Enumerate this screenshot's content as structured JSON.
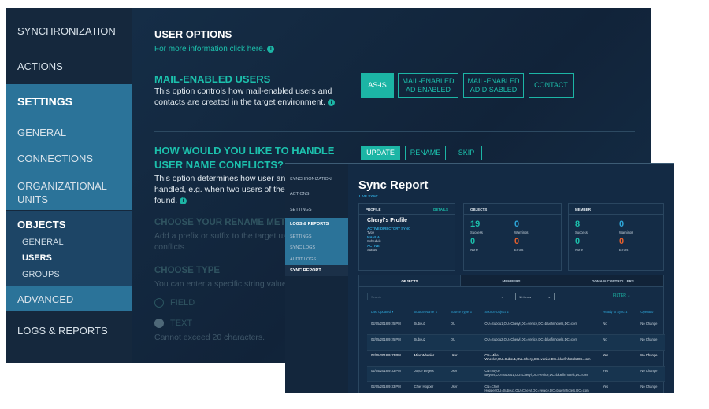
{
  "back": {
    "sidebar": {
      "synchronization": "SYNCHRONIZATION",
      "actions": "ACTIONS",
      "settings": "SETTINGS",
      "general": "GENERAL",
      "connections": "CONNECTIONS",
      "org_units": "ORGANIZATIONAL UNITS",
      "objects": "OBJECTS",
      "obj_general": "GENERAL",
      "users": "USERS",
      "groups": "GROUPS",
      "advanced": "ADVANCED",
      "logs": "LOGS & REPORTS"
    },
    "title": "USER OPTIONS",
    "more_info": "For more information click here.",
    "mail": {
      "heading": "MAIL-ENABLED USERS",
      "desc": "This option controls how mail-enabled users and contacts are created in the target environment.",
      "buttons": [
        "AS-IS",
        "MAIL-ENABLED AD ENABLED",
        "MAIL-ENABLED AD DISABLED",
        "CONTACT"
      ]
    },
    "conflict": {
      "heading1": "HOW WOULD YOU LIKE TO HANDLE",
      "heading2": "USER NAME CONFLICTS?",
      "desc1": "This option determines how user and co",
      "desc2": "handled, e.g. when two users of the sam",
      "desc3": "found.",
      "buttons": [
        "UPDATE",
        "RENAME",
        "SKIP"
      ]
    },
    "rename": {
      "heading": "CHOOSE YOUR RENAME METHOD",
      "desc1": "Add a prefix or suffix to the target user to",
      "desc2": "conflicts."
    },
    "type": {
      "heading": "CHOOSE TYPE",
      "desc": "You can enter a specific string value or s",
      "field": "FIELD",
      "text": "TEXT",
      "note": "Cannot exceed 20 characters."
    }
  },
  "front": {
    "sidebar": [
      "SYNCHRONIZATION",
      "ACTIONS",
      "SETTINGS",
      "LOGS & REPORTS",
      "SETTINGS",
      "SYNC LOGS",
      "AUDIT LOGS",
      "SYNC REPORT"
    ],
    "title": "Sync Report",
    "subtitle": "LIVE SYNC",
    "profile": {
      "header": "PROFILE",
      "details": "DETAILS",
      "name": "Cheryl's Profile",
      "type": "ACTIVE DIRECTORY SYNC",
      "type_l": "Type",
      "schedule": "MANUAL",
      "schedule_l": "Schedule",
      "status": "ACTIVE",
      "status_l": "Status"
    },
    "objects": {
      "header": "OBJECTS",
      "success": "19",
      "warnings": "0",
      "none": "0",
      "errors": "0"
    },
    "member": {
      "header": "MEMBER",
      "success": "8",
      "warnings": "0",
      "none": "0",
      "errors": "0"
    },
    "labels": {
      "success": "Success",
      "warnings": "Warnings",
      "none": "None",
      "errors": "Errors"
    },
    "tabs": [
      "OBJECTS",
      "MEMBERS",
      "DOMAIN CONTROLLERS"
    ],
    "search_placeholder": "Search",
    "items": "10 items",
    "filter": "FILTER ⌄",
    "columns": [
      "Last Updated ▾",
      "Source Name ⇕",
      "Source Type ⇕",
      "Source Object ⇕",
      "Ready to Sync ⇕",
      "Operatio"
    ],
    "rows": [
      [
        "02/05/2018 9:25 PM",
        "Subou1",
        "OU",
        "OU=Subou1,OU=Cheryl,DC=venice,DC=bluefinhotels,DC=com",
        "No",
        "No Change"
      ],
      [
        "02/05/2018 9:25 PM",
        "Subou2",
        "OU",
        "OU=Subou2,OU=Cheryl,DC=venice,DC=bluefinhotels,DC=com",
        "No",
        "No Change"
      ],
      [
        "02/05/2018 9:33 PM",
        "Mike Wheeler",
        "User",
        "CN=Mike Wheeler,OU=Subou1,OU=Cheryl,DC=venice,DC=bluefinhotels,DC=com",
        "Yes",
        "No Change"
      ],
      [
        "02/05/2018 9:33 PM",
        "Joyce Beyers",
        "User",
        "CN=Joyce Beyers,OU=Subou1,OU=Cheryl,DC=venice,DC=bluefinhotels,DC=com",
        "Yes",
        "No Change"
      ],
      [
        "02/05/2018 9:33 PM",
        "Chief Hopper",
        "User",
        "CN=Chief Hopper,OU=Subou1,OU=Cheryl,DC=venice,DC=bluefinhotels,DC=com",
        "Yes",
        "No Change"
      ]
    ]
  },
  "colors": {
    "teal": "#1cc0ac",
    "sidebar_active": "#2b7399",
    "warning": "#2ea6d8",
    "error": "#e8602c"
  }
}
